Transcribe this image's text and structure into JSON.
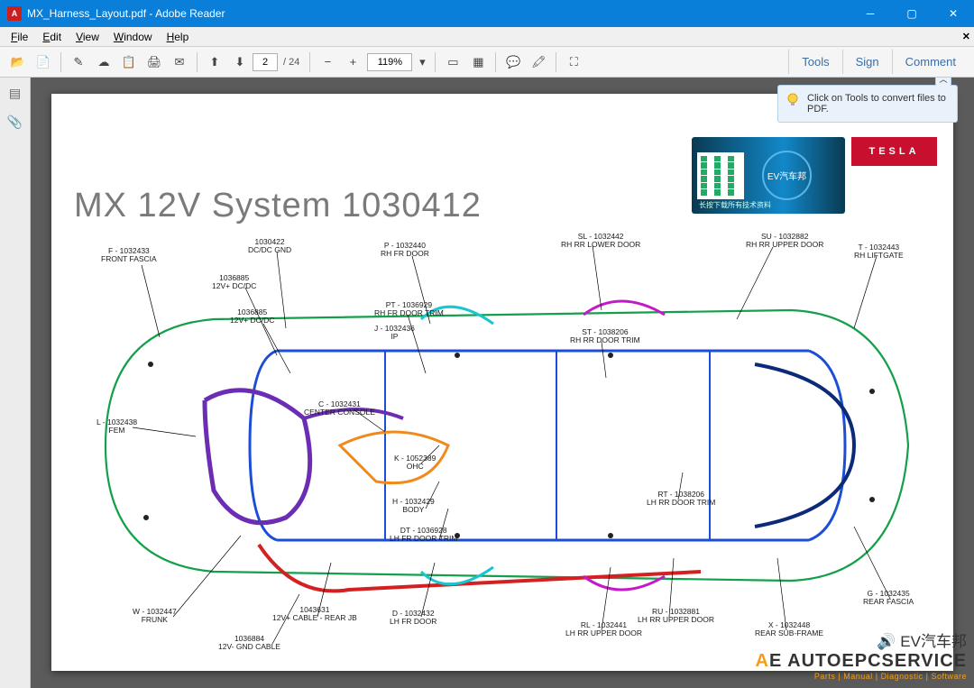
{
  "window": {
    "title": "MX_Harness_Layout.pdf - Adobe Reader",
    "min": "─",
    "max": "▢",
    "close": "✕"
  },
  "menu": {
    "file": "File",
    "edit": "Edit",
    "view": "View",
    "window": "Window",
    "help": "Help"
  },
  "toolbar": {
    "page_current": "2",
    "page_total": "/ 24",
    "zoom": "119%",
    "tools": "Tools",
    "sign": "Sign",
    "comment": "Comment"
  },
  "tooltip": {
    "text": "Click on Tools to convert files to PDF."
  },
  "document": {
    "title": "MX 12V System 1030412"
  },
  "brand": {
    "tesla": "TESLA",
    "ev_circle": "EV汽车邦",
    "ev_sub": "长按下载所有技术资料"
  },
  "labels": {
    "f": {
      "code": "F - 1032433",
      "name": "FRONT FASCIA"
    },
    "dc": {
      "code": "1030422",
      "name": "DC/DC GND"
    },
    "v1": {
      "code": "1036885",
      "name": "12V+ DC/DC"
    },
    "v2": {
      "code": "1036885",
      "name": "12V+ DC/DC"
    },
    "p": {
      "code": "P - 1032440",
      "name": "RH FR DOOR"
    },
    "sl": {
      "code": "SL - 1032442",
      "name": "RH RR LOWER DOOR"
    },
    "su": {
      "code": "SU - 1032882",
      "name": "RH RR UPPER DOOR"
    },
    "t": {
      "code": "T - 1032443",
      "name": "RH LIFTGATE"
    },
    "pt": {
      "code": "PT - 1036929",
      "name": "RH FR DOOR TRIM"
    },
    "j": {
      "code": "J - 1032436",
      "name": "IP"
    },
    "st": {
      "code": "ST - 1038206",
      "name": "RH RR DOOR TRIM"
    },
    "l": {
      "code": "L - 1032438",
      "name": "FEM"
    },
    "c": {
      "code": "C - 1032431",
      "name": "CENTER CONSOLE"
    },
    "k": {
      "code": "K - 1052389",
      "name": "OHC"
    },
    "h": {
      "code": "H - 1032429",
      "name": "BODY"
    },
    "rtx": {
      "code": "RT - 1038206",
      "name": "LH RR DOOR TRIM"
    },
    "dt": {
      "code": "DT - 1036928",
      "name": "LH FR DOOR TRIM"
    },
    "w": {
      "code": "W - 1032447",
      "name": "FRUNK"
    },
    "r12": {
      "code": "1043631",
      "name": "12V+ CABLE - REAR JB"
    },
    "gnd": {
      "code": "1036884",
      "name": "12V- GND CABLE"
    },
    "d": {
      "code": "D - 1032432",
      "name": "LH FR DOOR"
    },
    "rl": {
      "code": "RL - 1032441",
      "name": "LH RR UPPER DOOR"
    },
    "ru": {
      "code": "RU - 1032881",
      "name": "LH RR UPPER DOOR"
    },
    "x": {
      "code": "X - 1032448",
      "name": "REAR SUB-FRAME"
    },
    "g": {
      "code": "G - 1032435",
      "name": "REAR FASCIA"
    }
  },
  "watermark": {
    "l1": "🔊 EV汽车邦",
    "l2a": "A",
    "l2e": "E",
    "l2r": " AUTOEPCSERVICE",
    "l3": "Parts | Manual | Diagnostic | Software"
  }
}
